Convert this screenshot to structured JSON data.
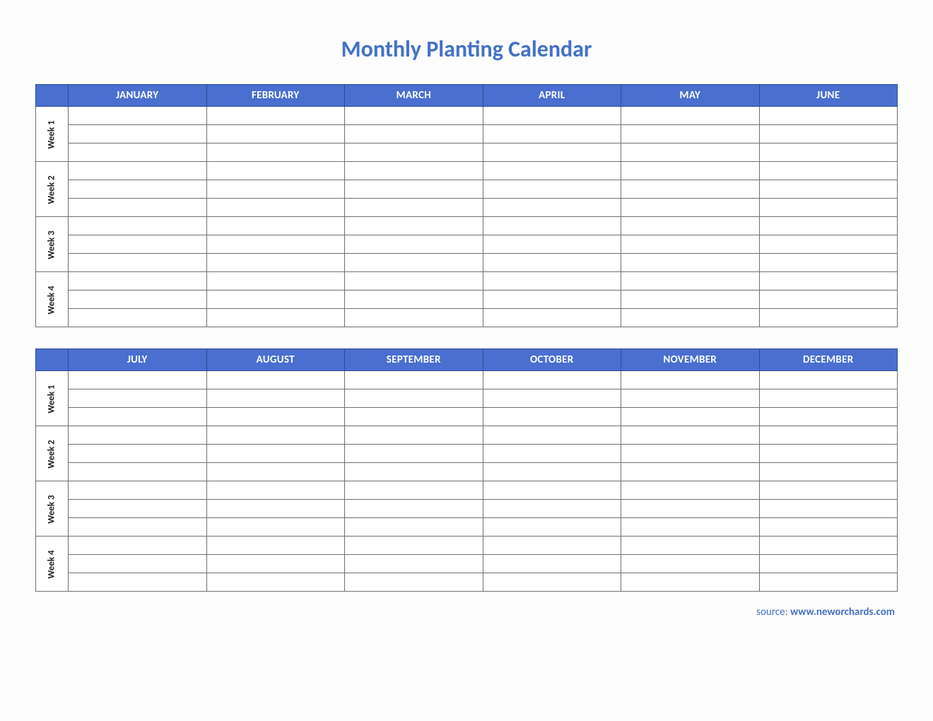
{
  "title": "Monthly Planting Calendar",
  "months_top": [
    "JANUARY",
    "FEBRUARY",
    "MARCH",
    "APRIL",
    "MAY",
    "JUNE"
  ],
  "months_bottom": [
    "JULY",
    "AUGUST",
    "SEPTEMBER",
    "OCTOBER",
    "NOVEMBER",
    "DECEMBER"
  ],
  "weeks": [
    "Week 1",
    "Week 2",
    "Week 3",
    "Week 4"
  ],
  "source_label": "source: ",
  "source_url": "www.neworchards.com",
  "colors": {
    "header_bg": "#4a6fd0",
    "title_color": "#4472c4"
  }
}
